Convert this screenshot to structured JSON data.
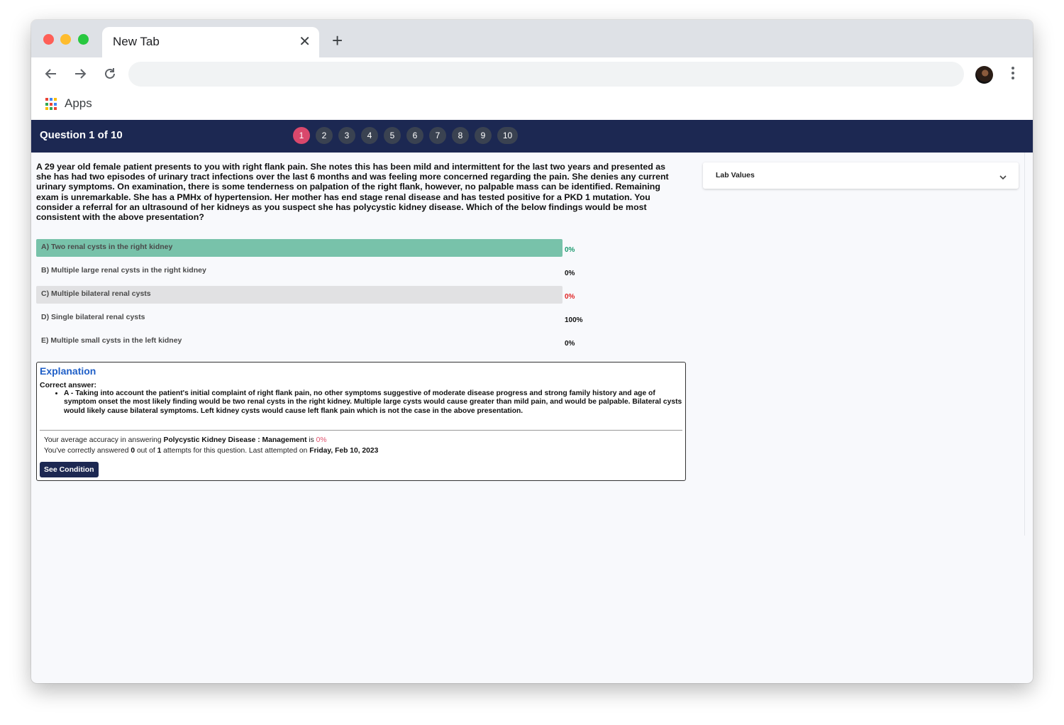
{
  "browser": {
    "tab_title": "New Tab",
    "bookmarks": {
      "apps_label": "Apps"
    }
  },
  "quiz": {
    "header_title": "Question 1 of 10",
    "question_numbers": [
      "1",
      "2",
      "3",
      "4",
      "5",
      "6",
      "7",
      "8",
      "9",
      "10"
    ],
    "active_question": "1",
    "question_text": "A 29 year old female patient presents to you with right flank pain. She notes this has been mild and intermittent for the last two years and presented as she has had two episodes of urinary tract infections over the last 6 months and was feeling more concerned regarding the pain. She denies any current urinary symptoms. On examination, there is some tenderness on palpation of the right flank, however, no palpable mass can be identified. Remaining exam is unremarkable. She has a PMHx  of hypertension. Her mother has end stage renal disease and has tested positive for a PKD 1 mutation. You consider a referral for an ultrasound of her kidneys as you suspect she has polycystic kidney disease. Which of the below findings would be most consistent with the above presentation?",
    "options": [
      {
        "label": "A) Two renal cysts in the right kidney",
        "percent": "0%",
        "state": "correct"
      },
      {
        "label": "B) Multiple large renal cysts in the right kidney",
        "percent": "0%",
        "state": "none"
      },
      {
        "label": "C) Multiple bilateral renal cysts",
        "percent": "0%",
        "state": "selected"
      },
      {
        "label": "D) Single bilateral renal cysts",
        "percent": "100%",
        "state": "none"
      },
      {
        "label": "E) Multiple small cysts in the left kidney",
        "percent": "0%",
        "state": "none"
      }
    ],
    "explanation": {
      "title": "Explanation",
      "correct_answer_label": "Correct answer:",
      "answer_prefix": "A - ",
      "answer_text": "Taking into account the patient's initial complaint of right flank pain, no other symptoms suggestive of moderate disease progress and strong family history and age of symptom onset the most likely finding would be two renal cysts in the right kidney. Multiple large cysts would cause greater than mild pain, and would be palpable. Bilateral cysts would likely cause bilateral symptoms. Left kidney cysts would cause left flank pain which is not the case in the above presentation.",
      "accuracy_prefix": "Your average accuracy in answering ",
      "accuracy_topic": "Polycystic Kidney Disease : Management",
      "accuracy_is": " is ",
      "accuracy_value": "0%",
      "answered_prefix": "You've correctly answered ",
      "answered_correct": "0",
      "answered_mid": " out of ",
      "answered_attempts": "1",
      "answered_suffix": " attempts for this question. Last attempted on ",
      "last_attempted": "Friday, Feb 10, 2023",
      "see_condition_label": "See Condition"
    },
    "lab_values_label": "Lab Values"
  },
  "colors": {
    "header_bg": "#1c2852",
    "active_question": "#d9486c",
    "correct_option_bg": "#78c2aa",
    "selected_option_bg": "#e1e1e3",
    "correct_percent": "#1a9a6e",
    "wrong_percent": "#e02424",
    "accuracy_value": "#e0526d",
    "explanation_title": "#1f5fc7"
  }
}
